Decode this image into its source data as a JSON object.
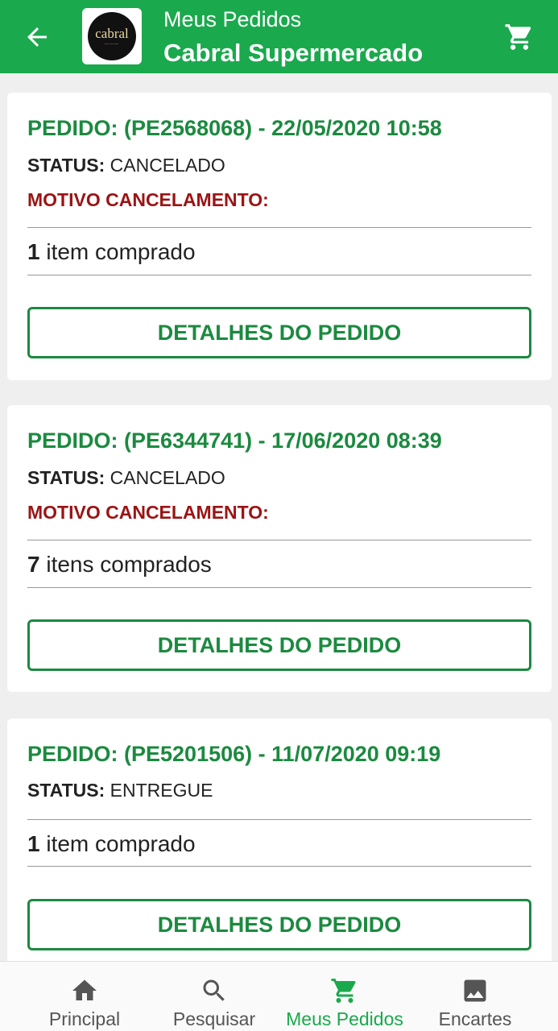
{
  "header": {
    "subtitle": "Meus Pedidos",
    "title": "Cabral Supermercado",
    "logo_text": "cabral",
    "back_icon": "arrow-back-icon",
    "cart_icon": "cart-icon"
  },
  "orders": [
    {
      "title": "PEDIDO: (PE2568068) - 22/05/2020 10:58",
      "status_label": "STATUS:",
      "status_value": " CANCELADO",
      "motivo": "MOTIVO CANCELAMENTO:",
      "items_count": "1",
      "items_text": " item comprado",
      "button": "DETALHES DO PEDIDO"
    },
    {
      "title": "PEDIDO: (PE6344741) - 17/06/2020 08:39",
      "status_label": "STATUS:",
      "status_value": " CANCELADO",
      "motivo": "MOTIVO CANCELAMENTO:",
      "items_count": "7",
      "items_text": " itens comprados",
      "button": "DETALHES DO PEDIDO"
    },
    {
      "title": "PEDIDO: (PE5201506) - 11/07/2020 09:19",
      "status_label": "STATUS:",
      "status_value": " ENTREGUE",
      "items_count": "1",
      "items_text": " item comprado",
      "button": "DETALHES DO PEDIDO"
    }
  ],
  "bottom_nav": [
    {
      "label": "Principal",
      "icon": "home-icon"
    },
    {
      "label": "Pesquisar",
      "icon": "search-icon"
    },
    {
      "label": "Meus Pedidos",
      "icon": "cart-icon",
      "active": true
    },
    {
      "label": "Encartes",
      "icon": "image-icon"
    }
  ],
  "colors": {
    "primary": "#1aa94d",
    "order_title": "#1b8a3f",
    "cancel_reason": "#9b1414"
  }
}
